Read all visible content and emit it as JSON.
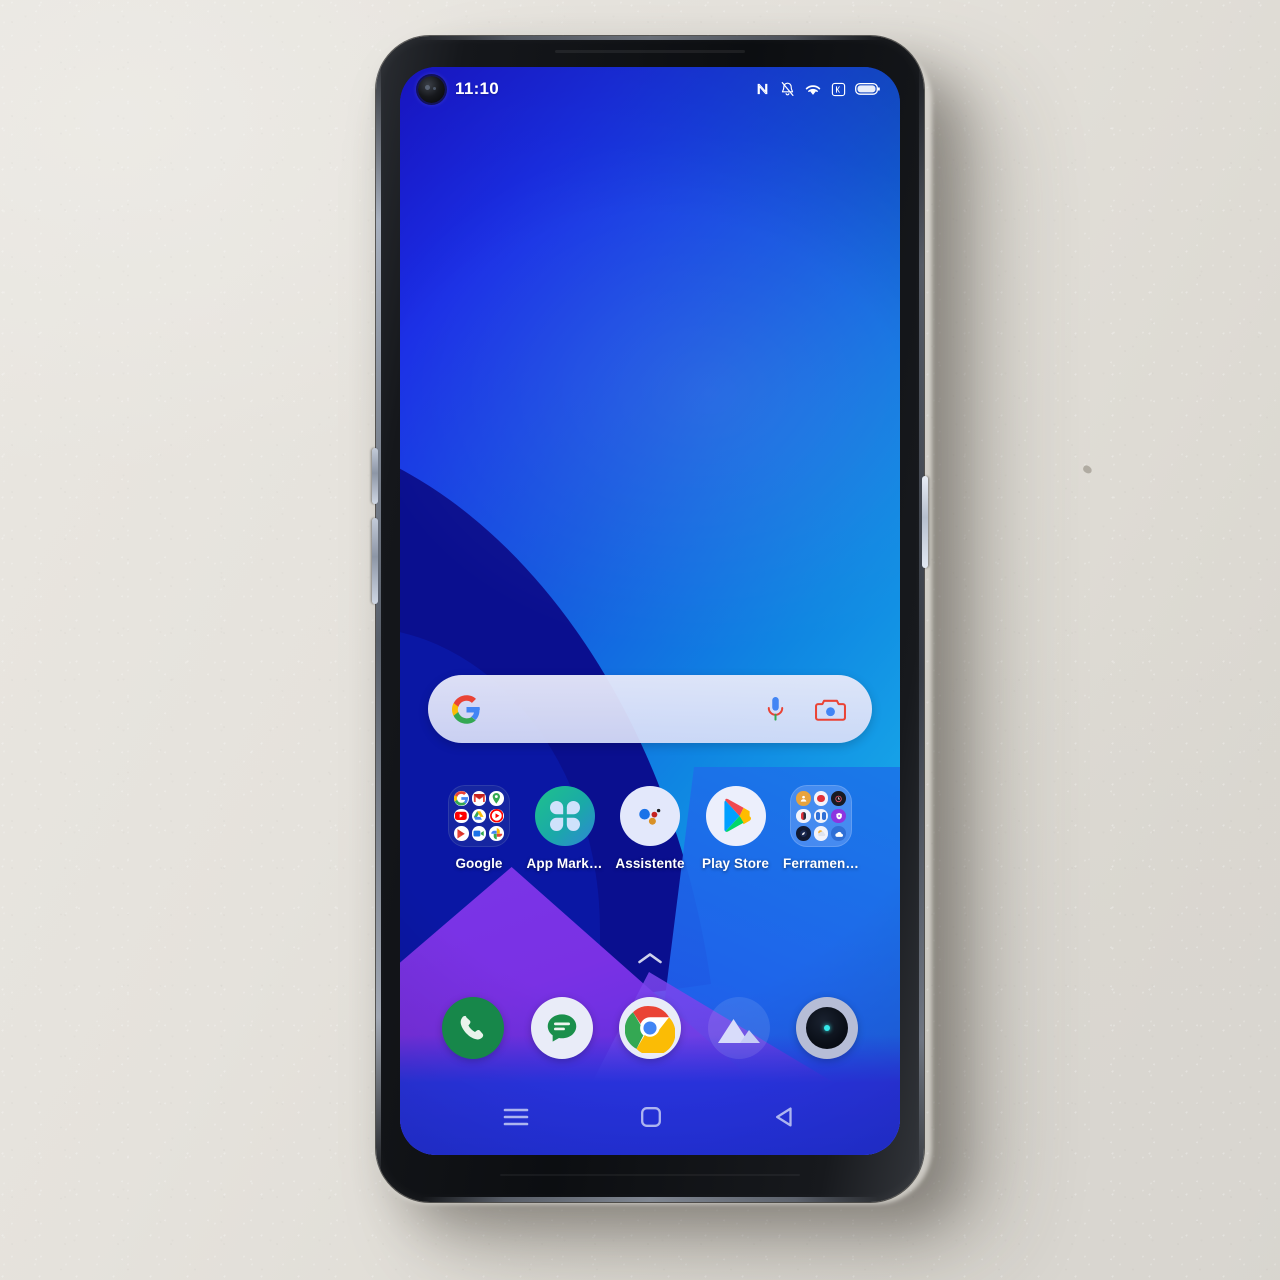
{
  "device": {
    "kind": "smartphone",
    "surface": "paper-desk-background",
    "body_color": "#121417",
    "frame_color": "#cdd6e4"
  },
  "status_bar": {
    "clock": "11:10",
    "icons": [
      {
        "name": "nfc-icon",
        "glyph": "N"
      },
      {
        "name": "notifications-silenced-icon",
        "glyph": "bell-slash"
      },
      {
        "name": "wifi-icon",
        "glyph": "wifi"
      },
      {
        "name": "signal-strength-icon",
        "glyph": "signal-box"
      },
      {
        "name": "battery-icon",
        "glyph": "battery-full"
      }
    ]
  },
  "search_widget": {
    "name": "google-search-bar",
    "placeholder": "",
    "logo": "google-g-logo",
    "actions": [
      {
        "name": "voice-search-icon",
        "label": "mic"
      },
      {
        "name": "google-lens-icon",
        "label": "lens"
      }
    ]
  },
  "home_screen": {
    "apps": [
      {
        "label": "Google",
        "type": "folder",
        "tile": "blueDark",
        "minis": [
          "google-g",
          "gmail",
          "maps",
          "youtube",
          "drive",
          "youtube-music",
          "play-movies",
          "meet",
          "photos"
        ]
      },
      {
        "label": "App Mark…",
        "type": "app",
        "icon": "app-market"
      },
      {
        "label": "Assistente",
        "type": "app",
        "icon": "google-assistant"
      },
      {
        "label": "Play Store",
        "type": "app",
        "icon": "play-store"
      },
      {
        "label": "Ferramen…",
        "type": "folder",
        "tile": "blueLight",
        "minis": [
          "contacts",
          "recorder",
          "clock",
          "themes",
          "calculator",
          "security",
          "compass",
          "weather",
          "cloud"
        ]
      }
    ],
    "app_drawer_handle": "chevron-up"
  },
  "dock": {
    "items": [
      {
        "name": "phone-app",
        "label": "Phone",
        "icon": "phone"
      },
      {
        "name": "messages-app",
        "label": "Messages",
        "icon": "messages"
      },
      {
        "name": "chrome-app",
        "label": "Chrome",
        "icon": "chrome"
      },
      {
        "name": "gallery-app",
        "label": "Gallery",
        "icon": "gallery-mountains"
      },
      {
        "name": "camera-app",
        "label": "Camera",
        "icon": "camera-lens"
      }
    ]
  },
  "nav_bar": {
    "buttons": [
      {
        "name": "recents-button",
        "glyph": "hamburger"
      },
      {
        "name": "home-button",
        "glyph": "square"
      },
      {
        "name": "back-button",
        "glyph": "triangle-left"
      }
    ]
  },
  "hardware_buttons": [
    {
      "name": "volume-up-button",
      "side": "left"
    },
    {
      "name": "volume-down-button",
      "side": "left"
    },
    {
      "name": "power-button",
      "side": "right"
    }
  ],
  "colors": {
    "wallpaper_blue_top": "#1c18e0",
    "wallpaper_cyan": "#1fb4ec",
    "wallpaper_navy": "#0a0f8f",
    "wallpaper_purple": "#7b36e8",
    "desk": "#e4e1db"
  }
}
